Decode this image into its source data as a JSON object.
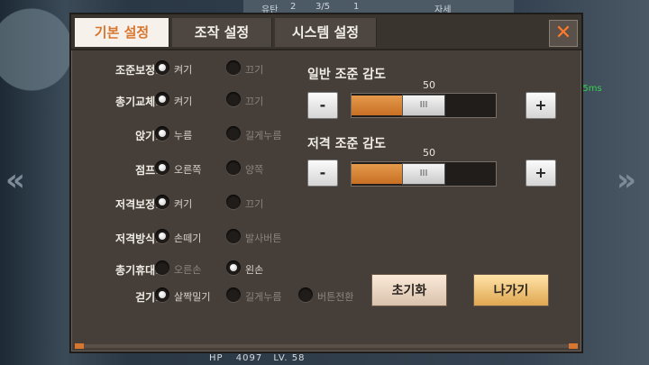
{
  "hud": {
    "top_left_text": "유탄",
    "top_count1": "2",
    "top_count2": "3/5",
    "top_count3": "1",
    "top_right_text": "자세",
    "ping": "65ms",
    "hp_label": "HP",
    "hp_value": "4097",
    "level": "LV. 58",
    "left_arrow": "«",
    "right_arrow": "»"
  },
  "tabs": [
    {
      "label": "기본 설정",
      "active": true
    },
    {
      "label": "조작 설정",
      "active": false
    },
    {
      "label": "시스템 설정",
      "active": false
    }
  ],
  "close_label": "✕",
  "settings": [
    {
      "label": "조준보정:",
      "options": [
        {
          "label": "켜기",
          "selected": true
        },
        {
          "label": "끄기",
          "selected": false
        }
      ]
    },
    {
      "label": "총기교체:",
      "options": [
        {
          "label": "켜기",
          "selected": true
        },
        {
          "label": "끄기",
          "selected": false
        }
      ]
    },
    {
      "label": "앉기:",
      "options": [
        {
          "label": "누름",
          "selected": true
        },
        {
          "label": "길게누름",
          "selected": false
        }
      ]
    },
    {
      "label": "점프:",
      "options": [
        {
          "label": "오른쪽",
          "selected": true
        },
        {
          "label": "양쪽",
          "selected": false
        }
      ]
    },
    {
      "label": "저격보정:",
      "options": [
        {
          "label": "켜기",
          "selected": true
        },
        {
          "label": "끄기",
          "selected": false
        }
      ]
    },
    {
      "label": "저격방식:",
      "options": [
        {
          "label": "손떼기",
          "selected": true
        },
        {
          "label": "발사버튼",
          "selected": false
        }
      ]
    },
    {
      "label": "총기휴대:",
      "options": [
        {
          "label": "오른손",
          "selected": false
        },
        {
          "label": "왼손",
          "selected": true
        }
      ]
    },
    {
      "label": "걷기:",
      "options": [
        {
          "label": "살짝밀기",
          "selected": true
        },
        {
          "label": "길게누름",
          "selected": false
        },
        {
          "label": "버튼전환",
          "selected": false
        }
      ]
    }
  ],
  "sliders": [
    {
      "label": "일반 조준 감도",
      "value": "50",
      "level": 0.5,
      "minus": "-",
      "plus": "+",
      "thumb_text": "III"
    },
    {
      "label": "저격 조준 감도",
      "value": "50",
      "level": 0.5,
      "minus": "-",
      "plus": "+",
      "thumb_text": "III"
    }
  ],
  "buttons": {
    "reset": "초기화",
    "exit": "나가기"
  },
  "colors": {
    "accent": "#d8762f",
    "panel": "#463f39"
  }
}
